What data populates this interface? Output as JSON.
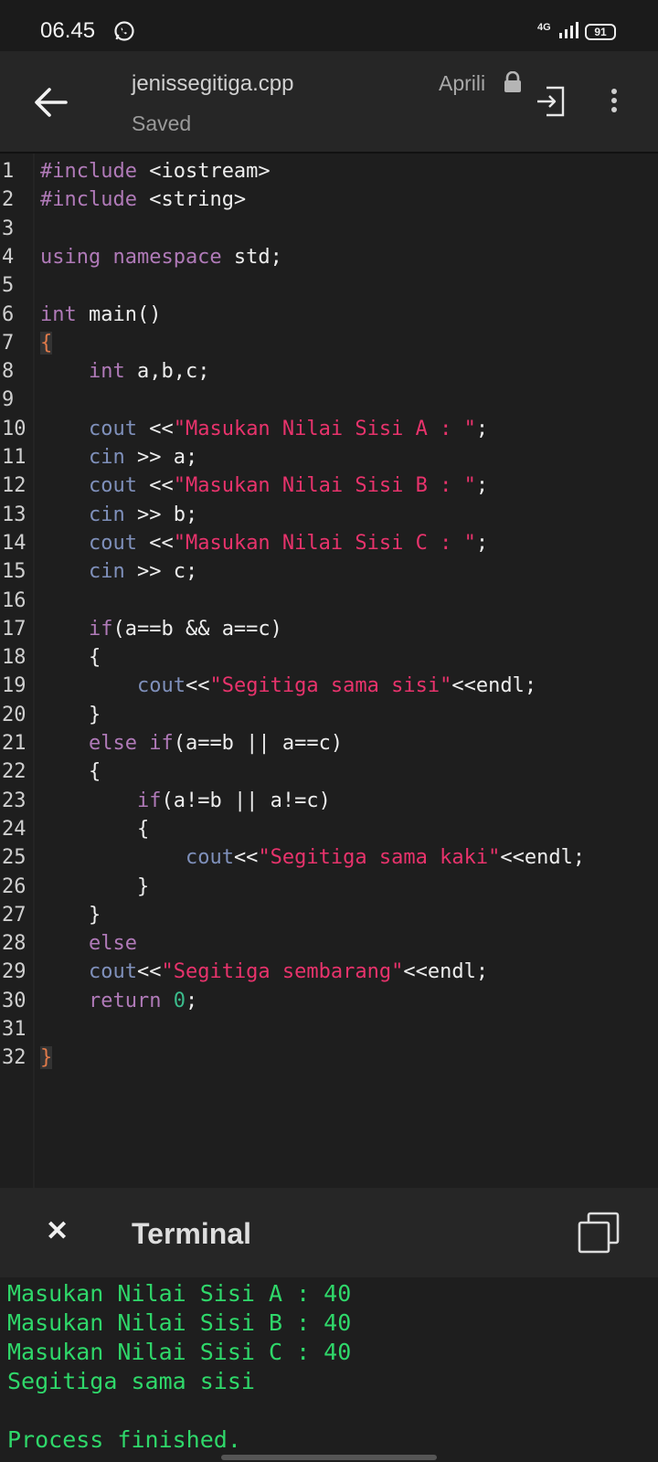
{
  "status": {
    "time": "06.45",
    "network": "4G",
    "battery": "91"
  },
  "appbar": {
    "file_name": "jenissegitiga.cpp",
    "save_state": "Saved",
    "owner": "Aprili"
  },
  "editor": {
    "lines": [
      [
        {
          "t": "#include ",
          "c": "kw"
        },
        {
          "t": "<iostream>",
          "c": ""
        }
      ],
      [
        {
          "t": "#include ",
          "c": "kw"
        },
        {
          "t": "<string>",
          "c": ""
        }
      ],
      [],
      [
        {
          "t": "using namespace ",
          "c": "kw"
        },
        {
          "t": "std;",
          "c": ""
        }
      ],
      [],
      [
        {
          "t": "int ",
          "c": "kw"
        },
        {
          "t": "main()",
          "c": ""
        }
      ],
      [
        {
          "t": "{",
          "c": "br"
        }
      ],
      [
        {
          "t": "    ",
          "c": ""
        },
        {
          "t": "int ",
          "c": "kw"
        },
        {
          "t": "a,b,c;",
          "c": ""
        }
      ],
      [],
      [
        {
          "t": "    ",
          "c": ""
        },
        {
          "t": "cout",
          "c": "ty"
        },
        {
          "t": " <<",
          "c": ""
        },
        {
          "t": "\"Masukan Nilai Sisi A : \"",
          "c": "st"
        },
        {
          "t": ";",
          "c": ""
        }
      ],
      [
        {
          "t": "    ",
          "c": ""
        },
        {
          "t": "cin",
          "c": "ty"
        },
        {
          "t": " >> a;",
          "c": ""
        }
      ],
      [
        {
          "t": "    ",
          "c": ""
        },
        {
          "t": "cout",
          "c": "ty"
        },
        {
          "t": " <<",
          "c": ""
        },
        {
          "t": "\"Masukan Nilai Sisi B : \"",
          "c": "st"
        },
        {
          "t": ";",
          "c": ""
        }
      ],
      [
        {
          "t": "    ",
          "c": ""
        },
        {
          "t": "cin",
          "c": "ty"
        },
        {
          "t": " >> b;",
          "c": ""
        }
      ],
      [
        {
          "t": "    ",
          "c": ""
        },
        {
          "t": "cout",
          "c": "ty"
        },
        {
          "t": " <<",
          "c": ""
        },
        {
          "t": "\"Masukan Nilai Sisi C : \"",
          "c": "st"
        },
        {
          "t": ";",
          "c": ""
        }
      ],
      [
        {
          "t": "    ",
          "c": ""
        },
        {
          "t": "cin",
          "c": "ty"
        },
        {
          "t": " >> c;",
          "c": ""
        }
      ],
      [],
      [
        {
          "t": "    ",
          "c": ""
        },
        {
          "t": "if",
          "c": "kw"
        },
        {
          "t": "(a==b && a==c)",
          "c": ""
        }
      ],
      [
        {
          "t": "    {",
          "c": ""
        }
      ],
      [
        {
          "t": "        ",
          "c": ""
        },
        {
          "t": "cout",
          "c": "ty"
        },
        {
          "t": "<<",
          "c": ""
        },
        {
          "t": "\"Segitiga sama sisi\"",
          "c": "st"
        },
        {
          "t": "<<endl;",
          "c": ""
        }
      ],
      [
        {
          "t": "    }",
          "c": ""
        }
      ],
      [
        {
          "t": "    ",
          "c": ""
        },
        {
          "t": "else if",
          "c": "kw"
        },
        {
          "t": "(a==b || a==c)",
          "c": ""
        }
      ],
      [
        {
          "t": "    {",
          "c": ""
        }
      ],
      [
        {
          "t": "        ",
          "c": ""
        },
        {
          "t": "if",
          "c": "kw"
        },
        {
          "t": "(a!=b || a!=c)",
          "c": ""
        }
      ],
      [
        {
          "t": "        {",
          "c": ""
        }
      ],
      [
        {
          "t": "            ",
          "c": ""
        },
        {
          "t": "cout",
          "c": "ty"
        },
        {
          "t": "<<",
          "c": ""
        },
        {
          "t": "\"Segitiga sama kaki\"",
          "c": "st"
        },
        {
          "t": "<<endl;",
          "c": ""
        }
      ],
      [
        {
          "t": "        }",
          "c": ""
        }
      ],
      [
        {
          "t": "    }",
          "c": ""
        }
      ],
      [
        {
          "t": "    ",
          "c": ""
        },
        {
          "t": "else",
          "c": "kw"
        }
      ],
      [
        {
          "t": "    ",
          "c": ""
        },
        {
          "t": "cout",
          "c": "ty"
        },
        {
          "t": "<<",
          "c": ""
        },
        {
          "t": "\"Segitiga sembarang\"",
          "c": "st"
        },
        {
          "t": "<<endl;",
          "c": ""
        }
      ],
      [
        {
          "t": "    ",
          "c": ""
        },
        {
          "t": "return ",
          "c": "kw"
        },
        {
          "t": "0",
          "c": "nm"
        },
        {
          "t": ";",
          "c": ""
        }
      ],
      [],
      [
        {
          "t": "}",
          "c": "br"
        }
      ]
    ]
  },
  "terminal": {
    "title": "Terminal",
    "output": [
      "Masukan Nilai Sisi A : 40",
      "Masukan Nilai Sisi B : 40",
      "Masukan Nilai Sisi C : 40",
      "Segitiga sama sisi",
      "",
      "Process finished."
    ]
  }
}
